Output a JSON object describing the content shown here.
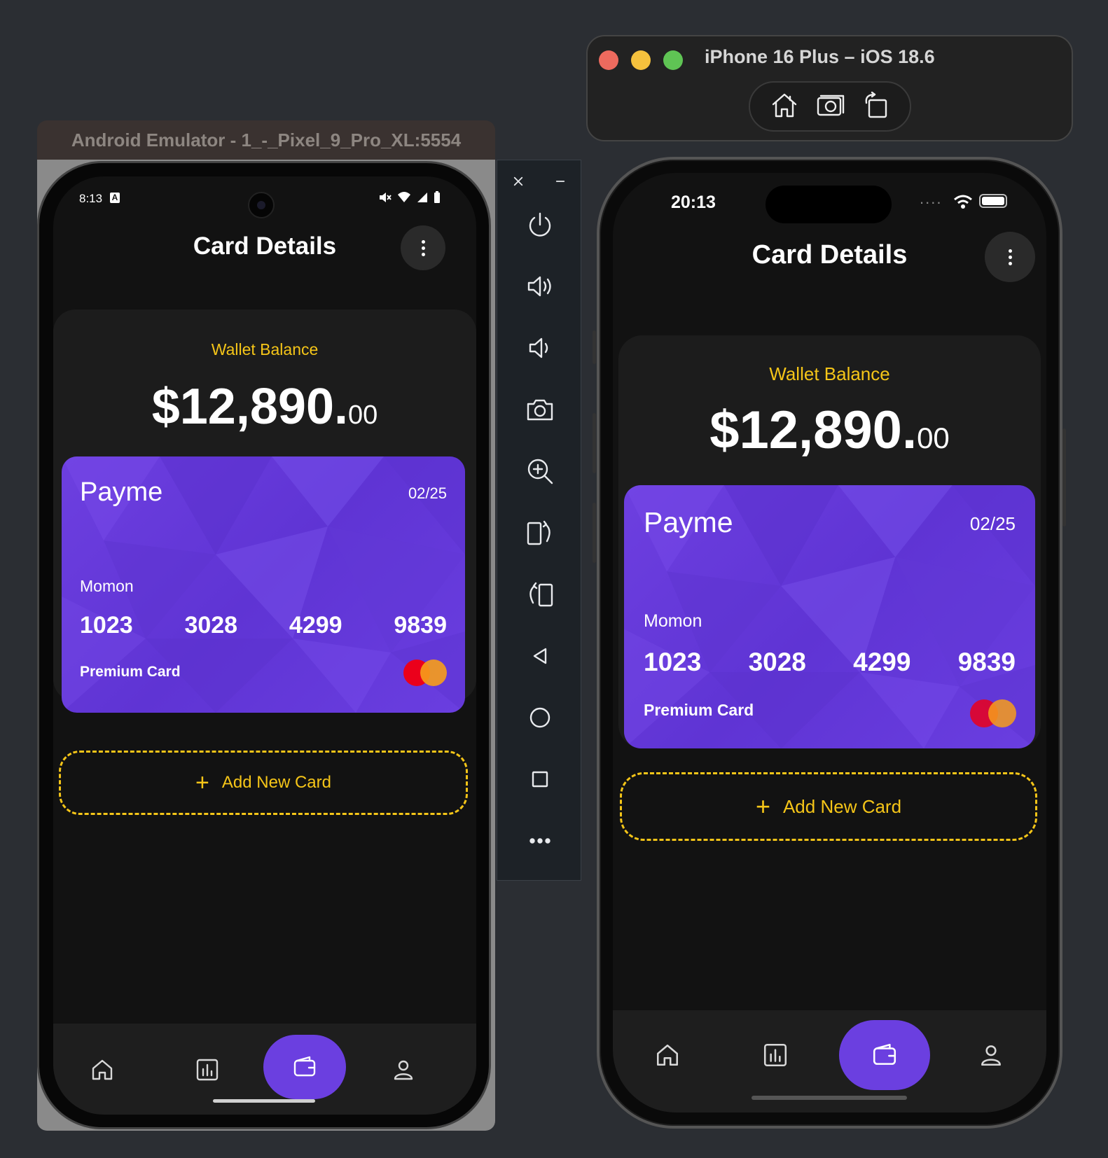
{
  "android": {
    "window_title": "Android Emulator - 1_-_Pixel_9_Pro_XL:5554",
    "status_time": "8:13",
    "status_a_badge": "A"
  },
  "ios": {
    "window_title": "iPhone 16 Plus – iOS 18.6",
    "status_time": "20:13",
    "signal_dots": "...."
  },
  "app": {
    "header_title": "Card Details",
    "wallet_label": "Wallet Balance",
    "balance_main": "$12,890.",
    "balance_cents": "00",
    "card": {
      "brand": "Payme",
      "expiry": "02/25",
      "holder": "Momon",
      "number_groups": [
        "1023",
        "3028",
        "4299",
        "9839"
      ],
      "tier": "Premium Card"
    },
    "add_card_label": "Add New Card",
    "add_card_icon": "+",
    "nav": [
      "home-icon",
      "stats-icon",
      "wallet-icon",
      "profile-icon"
    ],
    "nav_active": "wallet-icon"
  },
  "emulator_toolbar": [
    "close-icon",
    "minimize-icon",
    "power-icon",
    "volume-up-icon",
    "volume-down-icon",
    "camera-icon",
    "zoom-icon",
    "rotate-right-icon",
    "rotate-left-icon",
    "back-icon",
    "home-circle-icon",
    "overview-icon",
    "more-icon"
  ],
  "colors": {
    "accent_purple": "#6b3fe0",
    "accent_yellow": "#f5c518",
    "mastercard_red": "#eb001b",
    "mastercard_orange": "#f79e1b"
  }
}
